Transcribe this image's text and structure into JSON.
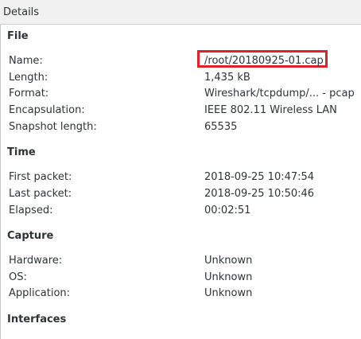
{
  "header": {
    "title": "Details"
  },
  "sections": {
    "file": {
      "title": "File",
      "rows": [
        {
          "label": "Name:",
          "value": "/root/20180925-01.cap"
        },
        {
          "label": "Length:",
          "value": "1,435 kB"
        },
        {
          "label": "Format:",
          "value": "Wireshark/tcpdump/... - pcap"
        },
        {
          "label": "Encapsulation:",
          "value": "IEEE 802.11 Wireless LAN"
        },
        {
          "label": "Snapshot length:",
          "value": "65535"
        }
      ]
    },
    "time": {
      "title": "Time",
      "rows": [
        {
          "label": "First packet:",
          "value": "2018-09-25 10:47:54"
        },
        {
          "label": "Last packet:",
          "value": "2018-09-25 10:50:46"
        },
        {
          "label": "Elapsed:",
          "value": "00:02:51"
        }
      ]
    },
    "capture": {
      "title": "Capture",
      "rows": [
        {
          "label": "Hardware:",
          "value": "Unknown"
        },
        {
          "label": "OS:",
          "value": "Unknown"
        },
        {
          "label": "Application:",
          "value": "Unknown"
        }
      ]
    },
    "interfaces": {
      "title": "Interfaces"
    }
  },
  "highlight_color": "#e0202a"
}
